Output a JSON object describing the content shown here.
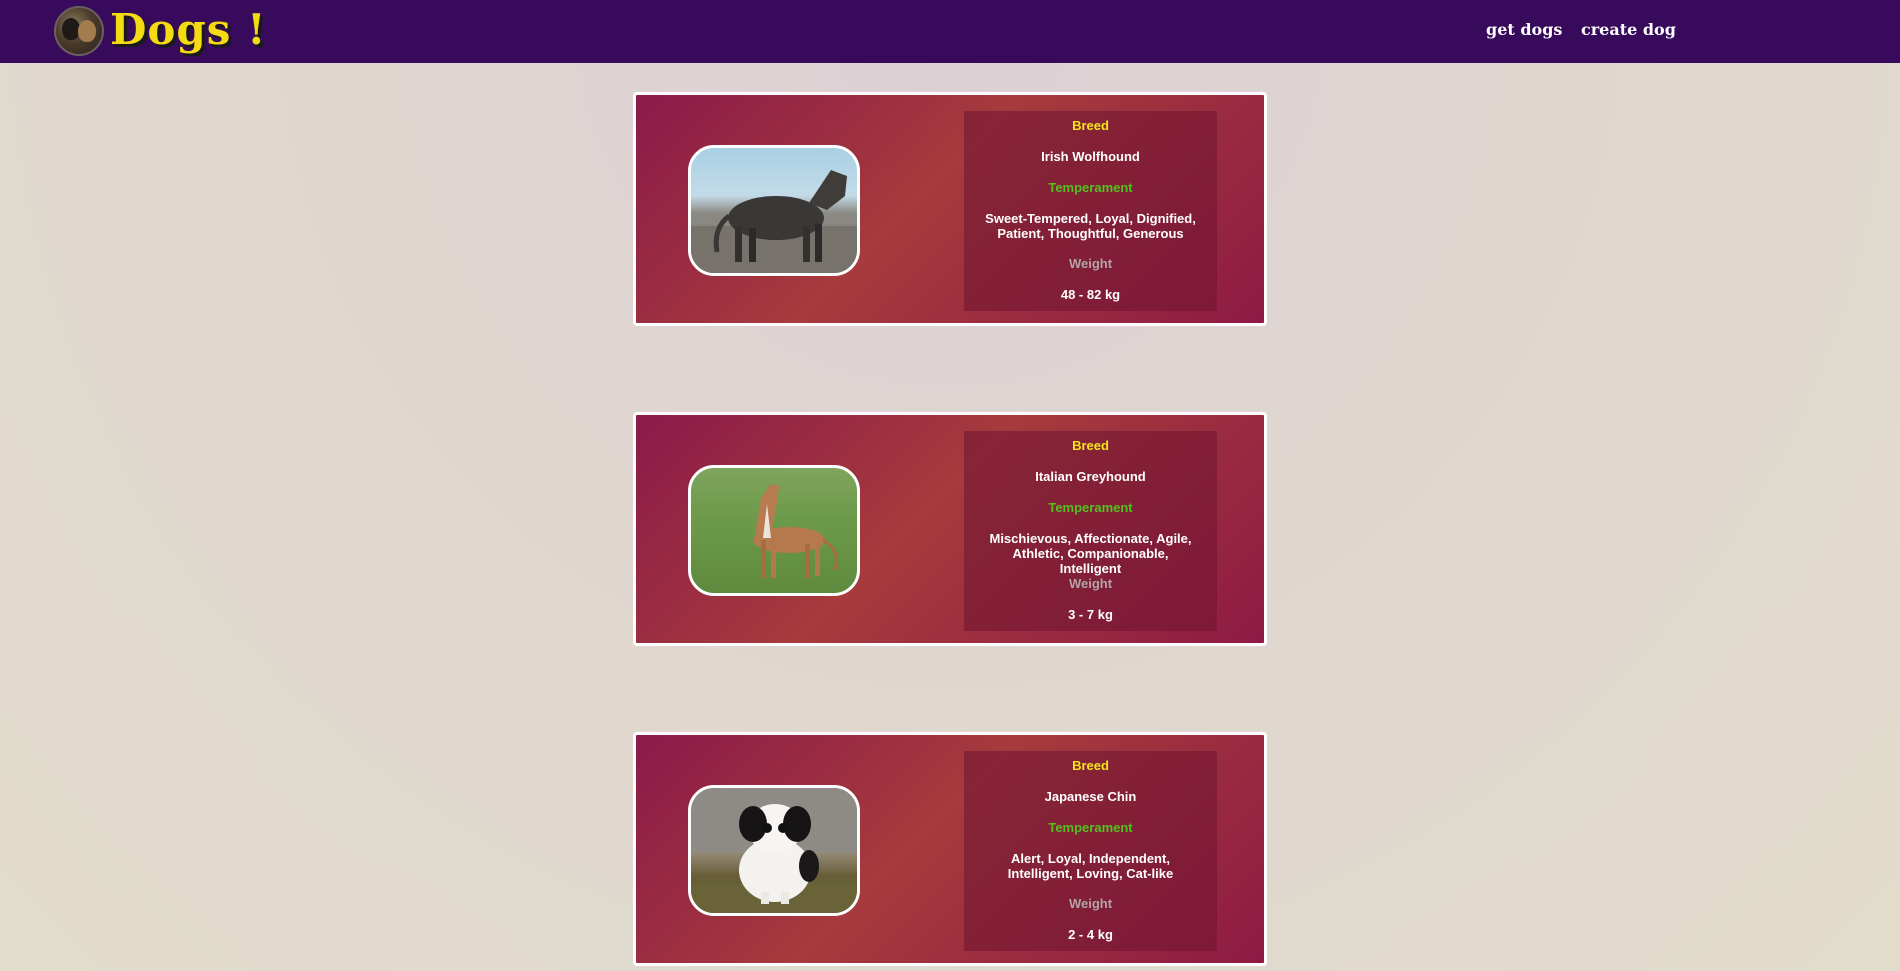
{
  "header": {
    "logo_text": "Dogs !",
    "nav": [
      {
        "label": "get dogs"
      },
      {
        "label": "create dog"
      }
    ]
  },
  "labels": {
    "breed": "Breed",
    "temperament": "Temperament",
    "weight": "Weight"
  },
  "cards": [
    {
      "breed": "Irish Wolfhound",
      "temperament": "Sweet-Tempered, Loyal, Dignified, Patient, Thoughtful, Generous",
      "weight": "48 - 82 kg"
    },
    {
      "breed": "Italian Greyhound",
      "temperament": "Mischievous, Affectionate, Agile, Athletic, Companionable, Intelligent",
      "weight": "3 - 7 kg"
    },
    {
      "breed": "Japanese Chin",
      "temperament": "Alert, Loyal, Independent, Intelligent, Loving, Cat-like",
      "weight": "2 - 4 kg"
    }
  ],
  "colors": {
    "navbar": "#380a5c",
    "logo_text": "#f4dc12",
    "breed_label": "#f6e51a",
    "temperament_label": "#53c11e",
    "weight_label": "#b3a3a8"
  }
}
